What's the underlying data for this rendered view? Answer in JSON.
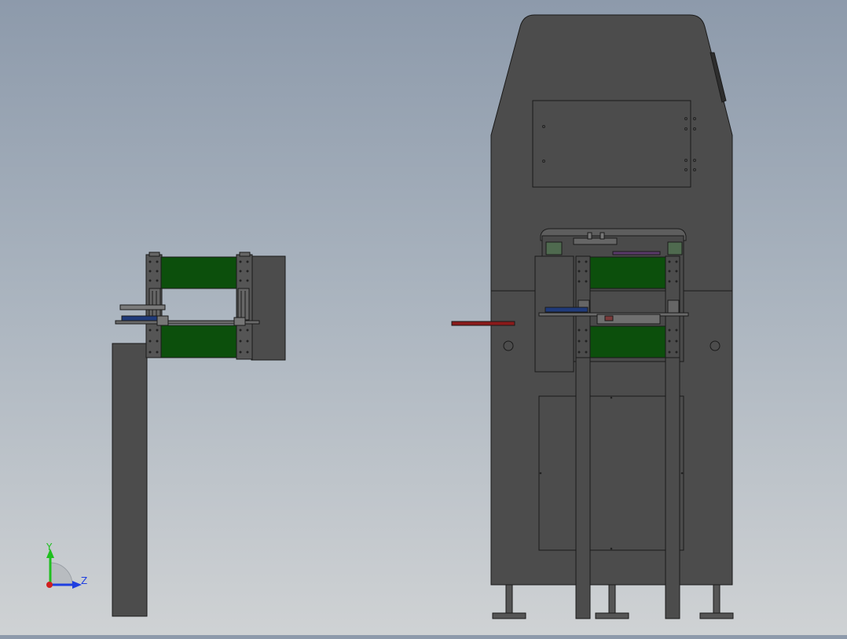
{
  "triad": {
    "y_label": "Y",
    "z_label": "Z",
    "y_color": "#1fbf1f",
    "z_color": "#1f3fe0",
    "x_color": "#d01f1f"
  },
  "colors": {
    "background_top": "#8d9aab",
    "background_bottom": "#cfd2d4",
    "body": "#4c4c4c",
    "edge": "#1a1a1a",
    "roller": "#0c4f0c",
    "handle": "#8b1a1a",
    "accent_blue": "#1f3a7a"
  },
  "icons": {
    "side_view": "machine-side-view-icon",
    "front_view": "machine-front-view-icon",
    "triad": "axis-triad-icon"
  }
}
